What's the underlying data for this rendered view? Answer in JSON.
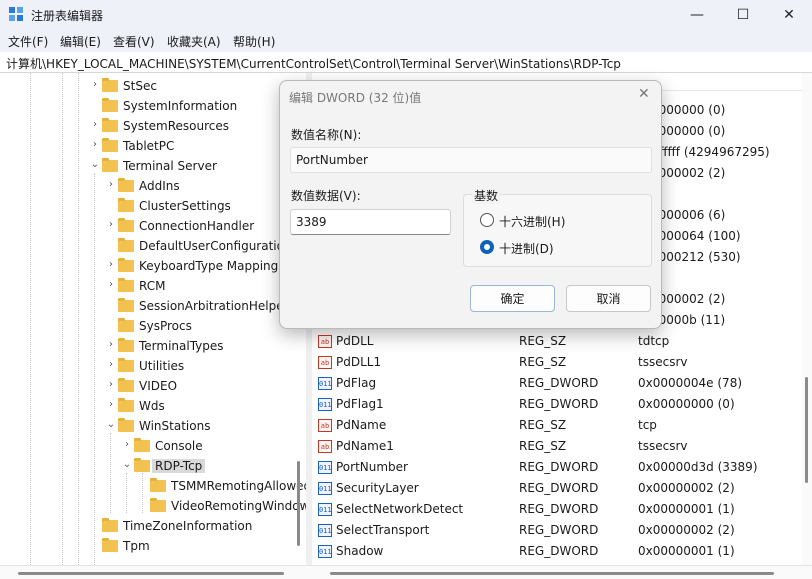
{
  "window": {
    "title": "注册表编辑器",
    "minimize": "—",
    "maximize": "☐",
    "close": "✕"
  },
  "menu": [
    "文件(F)",
    "编辑(E)",
    "查看(V)",
    "收藏夹(A)",
    "帮助(H)"
  ],
  "address": "计算机\\HKEY_LOCAL_MACHINE\\SYSTEM\\CurrentControlSet\\Control\\Terminal Server\\WinStations\\RDP-Tcp",
  "tree": {
    "items": [
      {
        "label": "StSec",
        "expanded": false
      },
      {
        "label": "SystemInformation",
        "expanded": null
      },
      {
        "label": "SystemResources",
        "expanded": false
      },
      {
        "label": "TabletPC",
        "expanded": false
      },
      {
        "label": "Terminal Server",
        "expanded": true
      },
      {
        "label": "AddIns",
        "expanded": false
      },
      {
        "label": "ClusterSettings",
        "expanded": null
      },
      {
        "label": "ConnectionHandler",
        "expanded": false
      },
      {
        "label": "DefaultUserConfiguration",
        "expanded": null
      },
      {
        "label": "KeyboardType Mapping",
        "expanded": false
      },
      {
        "label": "RCM",
        "expanded": false
      },
      {
        "label": "SessionArbitrationHelper",
        "expanded": null
      },
      {
        "label": "SysProcs",
        "expanded": null
      },
      {
        "label": "TerminalTypes",
        "expanded": false
      },
      {
        "label": "Utilities",
        "expanded": false
      },
      {
        "label": "VIDEO",
        "expanded": false
      },
      {
        "label": "Wds",
        "expanded": false
      },
      {
        "label": "WinStations",
        "expanded": true
      },
      {
        "label": "Console",
        "expanded": false
      },
      {
        "label": "RDP-Tcp",
        "expanded": true,
        "selected": true
      },
      {
        "label": "TSMMRemotingAllowedApps",
        "expanded": null
      },
      {
        "label": "VideoRemotingWindowNames",
        "expanded": null
      },
      {
        "label": "TimeZoneInformation",
        "expanded": null
      },
      {
        "label": "Tpm",
        "expanded": null
      }
    ]
  },
  "values": {
    "partial_data": [
      "0000000 (0)",
      "0000000 (0)",
      "fffffff (4294967295)",
      "0000002 (2)",
      "",
      "0000006 (6)",
      "0000064 (100)",
      "0000212 (530)",
      "",
      "0000002 (2)",
      "00000b (11)"
    ],
    "rows": [
      {
        "name": "PdDLL",
        "type": "REG_SZ",
        "data": "tdtcp",
        "kind": "sz"
      },
      {
        "name": "PdDLL1",
        "type": "REG_SZ",
        "data": "tssecsrv",
        "kind": "sz"
      },
      {
        "name": "PdFlag",
        "type": "REG_DWORD",
        "data": "0x0000004e (78)",
        "kind": "dw"
      },
      {
        "name": "PdFlag1",
        "type": "REG_DWORD",
        "data": "0x00000000 (0)",
        "kind": "dw"
      },
      {
        "name": "PdName",
        "type": "REG_SZ",
        "data": "tcp",
        "kind": "sz"
      },
      {
        "name": "PdName1",
        "type": "REG_SZ",
        "data": "tssecsrv",
        "kind": "sz"
      },
      {
        "name": "PortNumber",
        "type": "REG_DWORD",
        "data": "0x00000d3d (3389)",
        "kind": "dw"
      },
      {
        "name": "SecurityLayer",
        "type": "REG_DWORD",
        "data": "0x00000002 (2)",
        "kind": "dw"
      },
      {
        "name": "SelectNetworkDetect",
        "type": "REG_DWORD",
        "data": "0x00000001 (1)",
        "kind": "dw"
      },
      {
        "name": "SelectTransport",
        "type": "REG_DWORD",
        "data": "0x00000002 (2)",
        "kind": "dw"
      },
      {
        "name": "Shadow",
        "type": "REG_DWORD",
        "data": "0x00000001 (1)",
        "kind": "dw"
      }
    ]
  },
  "dialog": {
    "title": "编辑 DWORD (32 位)值",
    "close": "✕",
    "name_label": "数值名称(N):",
    "name_value": "PortNumber",
    "data_label": "数值数据(V):",
    "data_value": "3389",
    "base_label": "基数",
    "hex_label": "十六进制(H)",
    "dec_label": "十进制(D)",
    "selected_base": "dec",
    "ok": "确定",
    "cancel": "取消"
  },
  "icons": {
    "sz_glyph": "ab",
    "dw_glyph": "011",
    "chevron_right": "›",
    "chevron_down": "⌄"
  }
}
